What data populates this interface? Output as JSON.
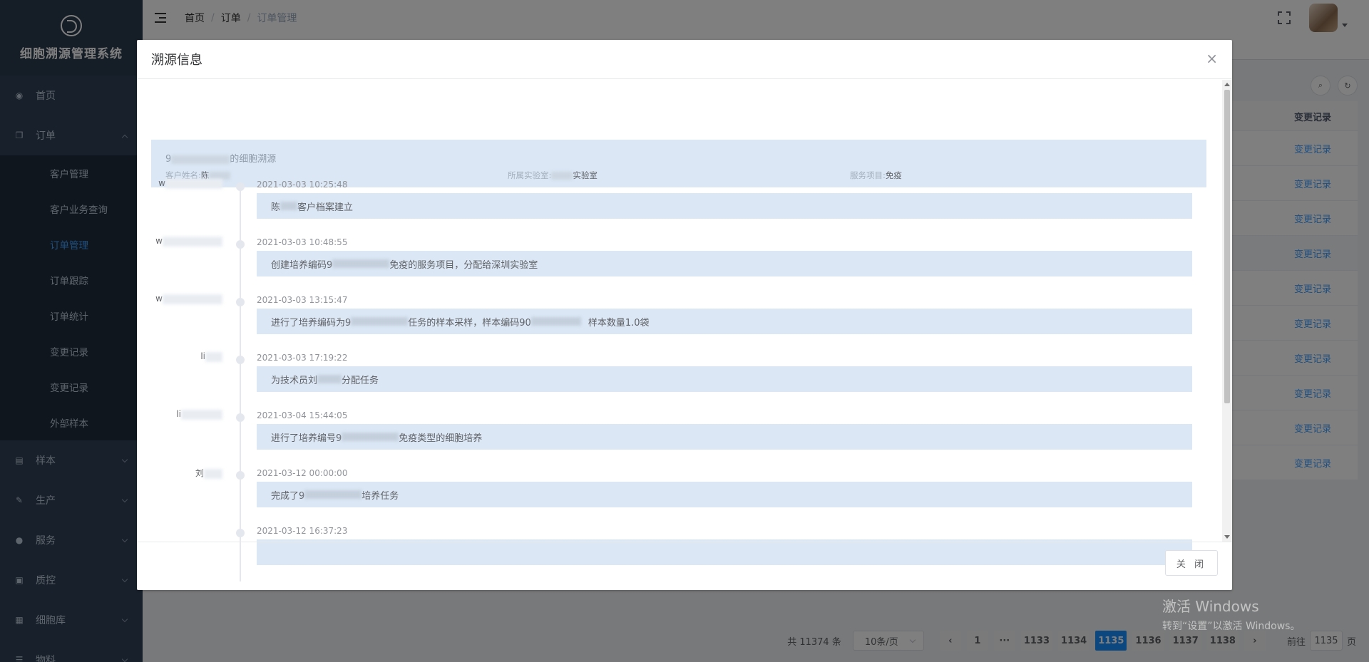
{
  "app": {
    "title": "细胞溯源管理系统"
  },
  "sidebar": {
    "items": [
      {
        "label": "首页",
        "icon": "dashboard-icon"
      },
      {
        "label": "订单",
        "icon": "clipboard-icon",
        "expanded": true
      },
      {
        "label": "样本",
        "icon": "document-icon"
      },
      {
        "label": "生产",
        "icon": "edit-icon"
      },
      {
        "label": "服务",
        "icon": "user-icon"
      },
      {
        "label": "质控",
        "icon": "report-icon"
      },
      {
        "label": "细胞库",
        "icon": "grid-icon"
      },
      {
        "label": "物料",
        "icon": "list-icon"
      }
    ],
    "submenu": [
      {
        "label": "客户管理"
      },
      {
        "label": "客户业务查询"
      },
      {
        "label": "订单管理",
        "active": true
      },
      {
        "label": "订单跟踪"
      },
      {
        "label": "订单统计"
      },
      {
        "label": "变更记录"
      },
      {
        "label": "变更记录"
      },
      {
        "label": "外部样本"
      }
    ]
  },
  "header": {
    "breadcrumb": [
      "首页",
      "订单",
      "订单管理"
    ],
    "separator": "/"
  },
  "table": {
    "column_header": "变更记录",
    "rows": [
      "变更记录",
      "变更记录",
      "变更记录",
      "变更记录",
      "变更记录",
      "变更记录",
      "变更记录",
      "变更记录",
      "变更记录",
      "变更记录"
    ]
  },
  "pagination": {
    "total": "共 11374 条",
    "page_size": "10条/页",
    "pages": [
      "1",
      "···",
      "1133",
      "1134",
      "1135",
      "1136",
      "1137",
      "1138"
    ],
    "current": "1135",
    "goto_prefix": "前往",
    "goto_value": "1135",
    "goto_suffix": "页",
    "prev": "‹",
    "next": "›"
  },
  "watermark": {
    "line1": "激活 Windows",
    "line2": "转到“设置”以激活 Windows。"
  },
  "dialog": {
    "title": "溯源信息",
    "close_icon": "×",
    "info": {
      "title_prefix": "9",
      "title_suffix": "的细胞溯源",
      "customer_label": "客户姓名:",
      "customer_value": "陈",
      "lab_label": "所属实验室:",
      "lab_value": "实验室",
      "service_label": "服务项目:",
      "service_value": "免疫"
    },
    "timeline": [
      {
        "name": "w",
        "time": "2021-03-03 10:25:48",
        "content_a": "陈",
        "content_b": "客户档案建立"
      },
      {
        "name": "w",
        "time": "2021-03-03 10:48:55",
        "content_a": "创建培养编码9",
        "content_b": "免疫的服务项目，分配给深圳实验室"
      },
      {
        "name": "w",
        "time": "2021-03-03 13:15:47",
        "content_a": "进行了培养编码为9",
        "content_b": "任务的样本采样，样本编码90",
        "content_c": "样本数量1.0袋"
      },
      {
        "name": "li",
        "time": "2021-03-03 17:19:22",
        "content_a": "为技术员刘",
        "content_b": "分配任务"
      },
      {
        "name": "li",
        "time": "2021-03-04 15:44:05",
        "content_a": "进行了培养编号9",
        "content_b": "免疫类型的细胞培养"
      },
      {
        "name": "刘",
        "time": "2021-03-12 00:00:00",
        "content_a": "完成了9",
        "content_b": "培养任务"
      },
      {
        "name": "",
        "time": "2021-03-12 16:37:23",
        "content_a": "",
        "content_b": ""
      }
    ],
    "footer_button": "关 闭"
  }
}
